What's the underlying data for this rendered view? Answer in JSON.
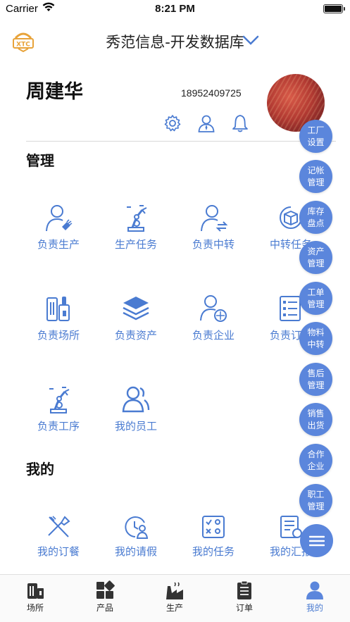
{
  "status_bar": {
    "carrier": "Carrier",
    "time": "8:21 PM"
  },
  "header": {
    "title": "秀范信息-开发数据库",
    "logo_text": "XTC"
  },
  "profile": {
    "name": "周建华",
    "phone": "18952409725"
  },
  "sections": {
    "manage": {
      "title": "管理",
      "items": [
        {
          "label": "负责生产",
          "icon": "person-production-icon"
        },
        {
          "label": "生产任务",
          "icon": "robot-arm-icon"
        },
        {
          "label": "负责中转",
          "icon": "person-transfer-icon"
        },
        {
          "label": "中转任务",
          "icon": "box-cycle-icon"
        },
        {
          "label": "负责场所",
          "icon": "building-icon"
        },
        {
          "label": "负责资产",
          "icon": "layers-icon"
        },
        {
          "label": "负责企业",
          "icon": "person-company-icon"
        },
        {
          "label": "负责订单",
          "icon": "order-list-icon"
        },
        {
          "label": "负责工序",
          "icon": "robot-arm-icon"
        },
        {
          "label": "我的员工",
          "icon": "staff-icon"
        }
      ]
    },
    "mine": {
      "title": "我的",
      "items": [
        {
          "label": "我的订餐",
          "icon": "fork-knife-icon"
        },
        {
          "label": "我的请假",
          "icon": "leave-icon"
        },
        {
          "label": "我的任务",
          "icon": "task-icon"
        },
        {
          "label": "我的汇报",
          "icon": "report-icon"
        }
      ]
    }
  },
  "fab_buttons": [
    "工厂设置",
    "记帐管理",
    "库存盘点",
    "资产管理",
    "工单管理",
    "物料中转",
    "售后管理",
    "销售出货",
    "合作企业",
    "职工管理"
  ],
  "tabbar": [
    {
      "label": "场所",
      "icon": "building-icon"
    },
    {
      "label": "产品",
      "icon": "grid-icon"
    },
    {
      "label": "生产",
      "icon": "factory-icon"
    },
    {
      "label": "订单",
      "icon": "clipboard-icon"
    },
    {
      "label": "我的",
      "icon": "user-icon",
      "active": true
    }
  ],
  "colors": {
    "accent": "#4a7bd1",
    "fab": "#5b86dc",
    "logo": "#e8a33a"
  }
}
